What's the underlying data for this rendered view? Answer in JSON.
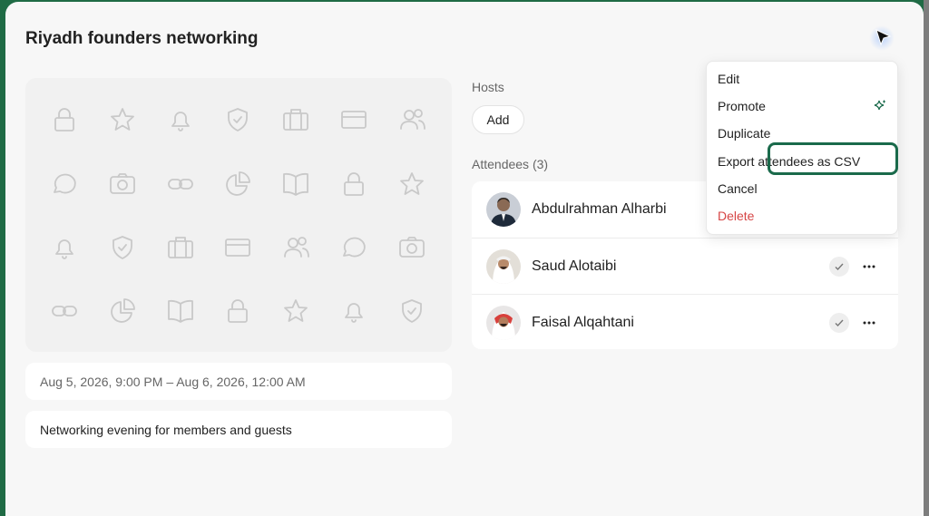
{
  "event": {
    "title": "Riyadh founders networking",
    "date_range": "Aug 5, 2026, 9:00 PM – Aug 6, 2026, 12:00 AM",
    "description": "Networking evening for members and guests"
  },
  "hosts": {
    "label": "Hosts",
    "add_label": "Add"
  },
  "attendees": {
    "label": "Attendees (3)",
    "items": [
      {
        "name": "Abdulrahman Alharbi"
      },
      {
        "name": "Saud Alotaibi"
      },
      {
        "name": "Faisal Alqahtani"
      }
    ]
  },
  "menu": {
    "items": [
      {
        "label": "Edit"
      },
      {
        "label": "Promote",
        "icon": "sparkle-icon"
      },
      {
        "label": "Duplicate"
      },
      {
        "label": "Export attendees as CSV"
      },
      {
        "label": "Cancel"
      },
      {
        "label": "Delete",
        "danger": true
      }
    ]
  },
  "icon_panel": {
    "icons": [
      [
        "lock",
        "star",
        "bell",
        "shield",
        "briefcase",
        "card",
        "users"
      ],
      [
        "chat",
        "camera",
        "link",
        "pie",
        "book",
        "lock",
        "star"
      ],
      [
        "bell",
        "shield",
        "briefcase",
        "card",
        "users",
        "chat",
        "camera"
      ],
      [
        "link",
        "pie",
        "book",
        "lock",
        "star",
        "bell",
        "shield"
      ]
    ]
  },
  "colors": {
    "accent": "#1a6a4b",
    "danger": "#d64545",
    "background": "#f7f7f7"
  }
}
